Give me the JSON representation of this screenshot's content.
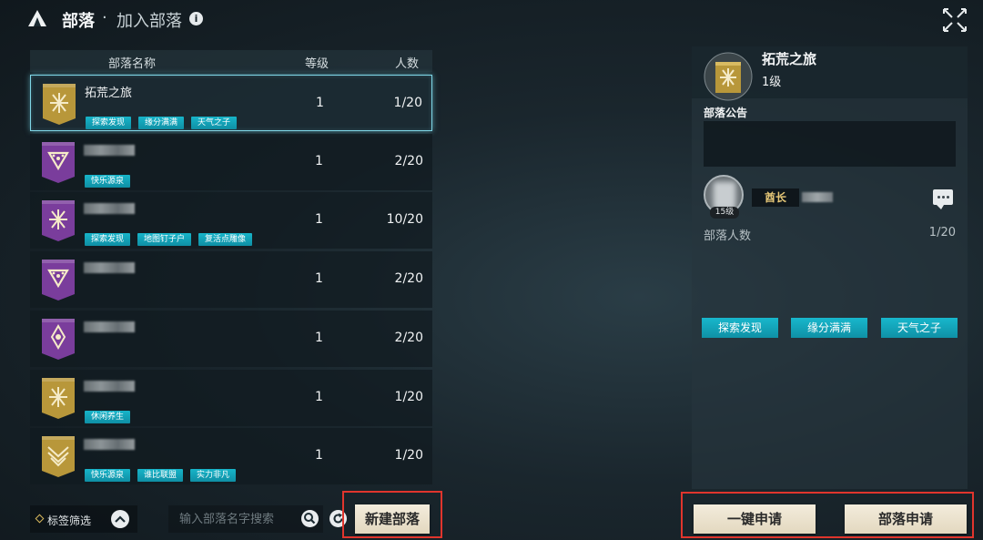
{
  "header": {
    "title": "部落",
    "separator": "·",
    "subtitle": "加入部落",
    "info_glyph": "i",
    "icons": [
      "tent-icon",
      "info-icon",
      "close-icon"
    ]
  },
  "list": {
    "columns": {
      "name": "部落名称",
      "level": "等级",
      "count": "人数"
    },
    "rows": [
      {
        "name": "拓荒之旅",
        "name_visible": true,
        "level": "1",
        "count": "1/20",
        "banner": "gold",
        "emblem": "star",
        "selected": true,
        "tags": [
          "探索发现",
          "缘分满满",
          "天气之子"
        ]
      },
      {
        "name": "",
        "name_visible": false,
        "level": "1",
        "count": "2/20",
        "banner": "purple",
        "emblem": "triangle",
        "selected": false,
        "tags": [
          "快乐源泉"
        ]
      },
      {
        "name": "",
        "name_visible": false,
        "level": "1",
        "count": "10/20",
        "banner": "purple",
        "emblem": "star",
        "selected": false,
        "tags": [
          "探索发现",
          "地图钉子户",
          "复活点雕像"
        ]
      },
      {
        "name": "",
        "name_visible": false,
        "level": "1",
        "count": "2/20",
        "banner": "purple",
        "emblem": "triangle",
        "selected": false,
        "tags": []
      },
      {
        "name": "",
        "name_visible": false,
        "level": "1",
        "count": "2/20",
        "banner": "purple",
        "emblem": "flame",
        "selected": false,
        "tags": []
      },
      {
        "name": "",
        "name_visible": false,
        "level": "1",
        "count": "1/20",
        "banner": "gold",
        "emblem": "star",
        "selected": false,
        "tags": [
          "休闲养生"
        ]
      },
      {
        "name": "",
        "name_visible": false,
        "level": "1",
        "count": "1/20",
        "banner": "gold",
        "emblem": "wings",
        "selected": false,
        "tags": [
          "快乐源泉",
          "谁比联盟",
          "实力非凡"
        ]
      }
    ]
  },
  "controls": {
    "filter_label": "标签筛选",
    "search_placeholder": "输入部落名字搜索",
    "new_button": "新建部落",
    "apply_one_button": "一键申请",
    "apply_button": "部落申请"
  },
  "detail": {
    "name": "拓荒之旅",
    "level": "1级",
    "announcement_title": "部落公告",
    "announcement": "",
    "leader_level": "15级",
    "leader_role": "酋长",
    "members_label": "部落人数",
    "members_value": "1/20",
    "tags": [
      "探索发现",
      "缘分满满",
      "天气之子"
    ]
  },
  "colors": {
    "gold_banner": "#b8973a",
    "purple_banner": "#7a3d9c",
    "tag_cyan": "#17b4c9",
    "selection_glow": "#7fd6e6",
    "highlight_red": "#e0352d",
    "button_cream": "#ece3cf"
  }
}
